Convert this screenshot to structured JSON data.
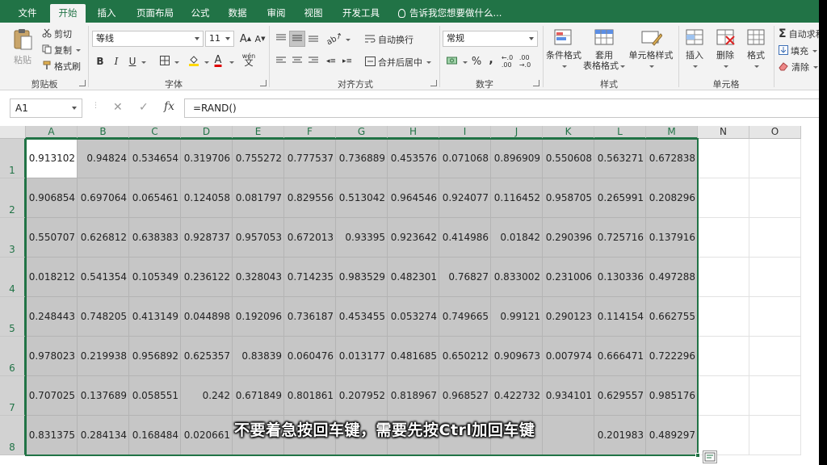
{
  "tabs": [
    "文件",
    "开始",
    "插入",
    "页面布局",
    "公式",
    "数据",
    "审阅",
    "视图",
    "开发工具"
  ],
  "active_tab": "开始",
  "tell_me": "告诉我您想要做什么...",
  "ribbon": {
    "clipboard": {
      "paste": "粘贴",
      "cut": "剪切",
      "copy": "复制",
      "format_painter": "格式刷",
      "label": "剪贴板"
    },
    "font": {
      "name": "等线",
      "size": "11",
      "grow": "A",
      "shrink": "A",
      "bold": "B",
      "italic": "I",
      "underline": "U",
      "label": "字体",
      "phonetic": "wén"
    },
    "alignment": {
      "wrap": "自动换行",
      "merge": "合并后居中",
      "label": "对齐方式"
    },
    "number": {
      "format": "常规",
      "percent": "%",
      "comma": ",",
      "label": "数字"
    },
    "styles": {
      "conditional": "条件格式",
      "table_line1": "套用",
      "table_line2": "表格格式",
      "cell_styles": "单元格样式",
      "label": "样式"
    },
    "cells": {
      "insert": "插入",
      "delete": "删除",
      "format": "格式",
      "label": "单元格"
    },
    "editing": {
      "autosum": "自动求和",
      "fill": "填充",
      "clear": "清除"
    }
  },
  "formula_bar": {
    "name_box": "A1",
    "cancel": "✕",
    "enter": "✓",
    "fx": "fx",
    "formula": "=RAND()"
  },
  "columns": [
    "A",
    "B",
    "C",
    "D",
    "E",
    "F",
    "G",
    "H",
    "I",
    "J",
    "K",
    "L",
    "M",
    "N",
    "O"
  ],
  "rows": [
    [
      "0.913102",
      "0.94824",
      "0.534654",
      "0.319706",
      "0.755272",
      "0.777537",
      "0.736889",
      "0.453576",
      "0.071068",
      "0.896909",
      "0.550608",
      "0.563271",
      "0.672838"
    ],
    [
      "0.906854",
      "0.697064",
      "0.065461",
      "0.124058",
      "0.081797",
      "0.829556",
      "0.513042",
      "0.964546",
      "0.924077",
      "0.116452",
      "0.958705",
      "0.265991",
      "0.208296"
    ],
    [
      "0.550707",
      "0.626812",
      "0.638383",
      "0.928737",
      "0.957053",
      "0.672013",
      "0.93395",
      "0.923642",
      "0.414986",
      "0.01842",
      "0.290396",
      "0.725716",
      "0.137916"
    ],
    [
      "0.018212",
      "0.541354",
      "0.105349",
      "0.236122",
      "0.328043",
      "0.714235",
      "0.983529",
      "0.482301",
      "0.76827",
      "0.833002",
      "0.231006",
      "0.130336",
      "0.497288"
    ],
    [
      "0.248443",
      "0.748205",
      "0.413149",
      "0.044898",
      "0.192096",
      "0.736187",
      "0.453455",
      "0.053274",
      "0.749665",
      "0.99121",
      "0.290123",
      "0.114154",
      "0.662755"
    ],
    [
      "0.978023",
      "0.219938",
      "0.956892",
      "0.625357",
      "0.83839",
      "0.060476",
      "0.013177",
      "0.481685",
      "0.650212",
      "0.909673",
      "0.007974",
      "0.666471",
      "0.722296"
    ],
    [
      "0.707025",
      "0.137689",
      "0.058551",
      "0.242",
      "0.671849",
      "0.801861",
      "0.207952",
      "0.818967",
      "0.968527",
      "0.422732",
      "0.934101",
      "0.629557",
      "0.985176"
    ],
    [
      "0.831375",
      "0.284134",
      "0.168484",
      "0.020661",
      "",
      "",
      "",
      "",
      "",
      "",
      "",
      "0.201983",
      "0.489297"
    ]
  ],
  "caption": "不要着急按回车键，需要先按Ctrl加回车键",
  "colors": {
    "accent": "#217346",
    "selection": "#c6c6c6"
  }
}
